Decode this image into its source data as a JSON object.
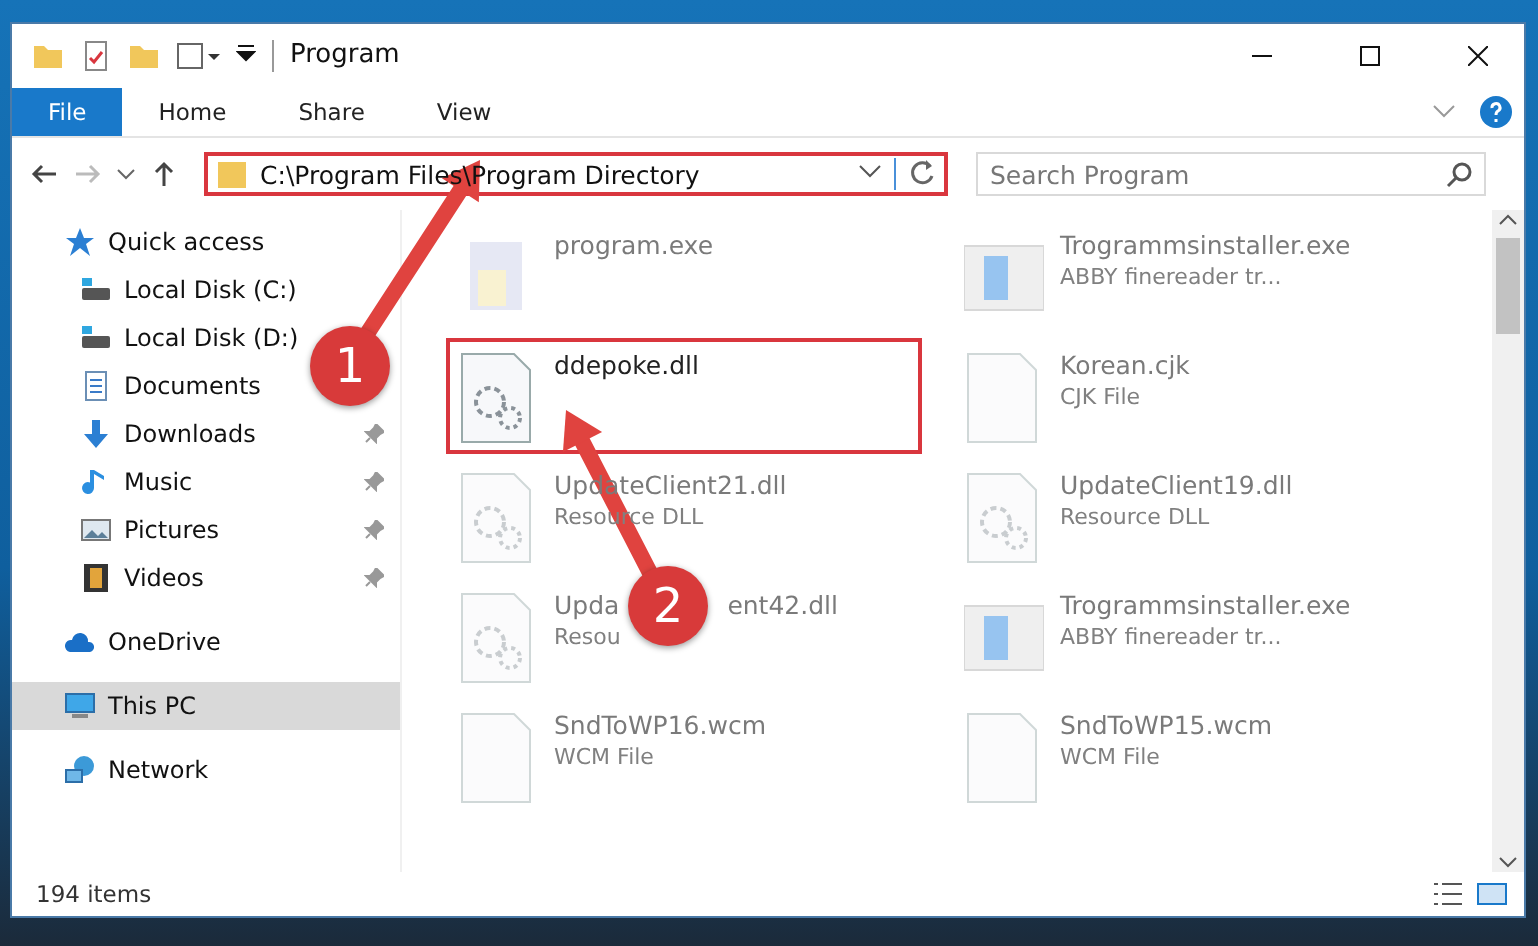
{
  "window": {
    "title": "Program"
  },
  "ribbon": {
    "tabs": [
      {
        "label": "File",
        "kind": "file",
        "selected": true
      },
      {
        "label": "Home",
        "kind": "tab",
        "selected": false
      },
      {
        "label": "Share",
        "kind": "tab",
        "selected": false
      },
      {
        "label": "View",
        "kind": "tab",
        "selected": false
      }
    ]
  },
  "address": {
    "path": "C:\\Program Files\\Program Directory",
    "highlighted": true
  },
  "search": {
    "placeholder": "Search Program"
  },
  "sidebar": {
    "items": [
      {
        "label": "Quick access",
        "kind": "star",
        "selected": false,
        "children": [
          {
            "label": "Local Disk (C:)",
            "kind": "disk",
            "pinned": false
          },
          {
            "label": "Local Disk (D:)",
            "kind": "disk",
            "pinned": false
          },
          {
            "label": "Documents",
            "kind": "doc",
            "pinned": false
          },
          {
            "label": "Downloads",
            "kind": "download",
            "pinned": true
          },
          {
            "label": "Music",
            "kind": "music",
            "pinned": true
          },
          {
            "label": "Pictures",
            "kind": "pictures",
            "pinned": true
          },
          {
            "label": "Videos",
            "kind": "videos",
            "pinned": true
          }
        ]
      },
      {
        "label": "OneDrive",
        "kind": "cloud",
        "selected": false
      },
      {
        "label": "This PC",
        "kind": "pc",
        "selected": true
      },
      {
        "label": "Network",
        "kind": "network",
        "selected": false
      }
    ]
  },
  "files": [
    {
      "name": "program.exe",
      "kind": "exe",
      "dimmed": true,
      "highlighted": false
    },
    {
      "name": "Trogrammsinstaller.exe",
      "type": "ABBY finereader tr...",
      "kind": "app",
      "dimmed": true,
      "highlighted": false
    },
    {
      "name": "ddepoke.dll",
      "kind": "dll",
      "dimmed": false,
      "highlighted": true
    },
    {
      "name": "Korean.cjk",
      "type": "CJK File",
      "kind": "blank",
      "dimmed": true,
      "highlighted": false
    },
    {
      "name": "UpdateClient21.dll",
      "type": "Resource DLL",
      "kind": "dll",
      "dimmed": true,
      "highlighted": false
    },
    {
      "name": "UpdateClient19.dll",
      "type": "Resource DLL",
      "kind": "dll",
      "dimmed": true,
      "highlighted": false
    },
    {
      "name": "Upda",
      "name_end": "ent42.dll",
      "type": "Resou",
      "kind": "dll",
      "dimmed": true,
      "highlighted": false
    },
    {
      "name": "Trogrammsinstaller.exe",
      "type": "ABBY finereader tr...",
      "kind": "app",
      "dimmed": true,
      "highlighted": false
    },
    {
      "name": "SndToWP16.wcm",
      "type": "WCM File",
      "kind": "blank",
      "dimmed": true,
      "highlighted": false
    },
    {
      "name": "SndToWP15.wcm",
      "type": "WCM File",
      "kind": "blank",
      "dimmed": true,
      "highlighted": false
    }
  ],
  "status_bar": {
    "count": "194 items"
  },
  "annotations": [
    {
      "label": "1",
      "kind": "arrow"
    },
    {
      "label": "2",
      "kind": "arrow"
    }
  ]
}
